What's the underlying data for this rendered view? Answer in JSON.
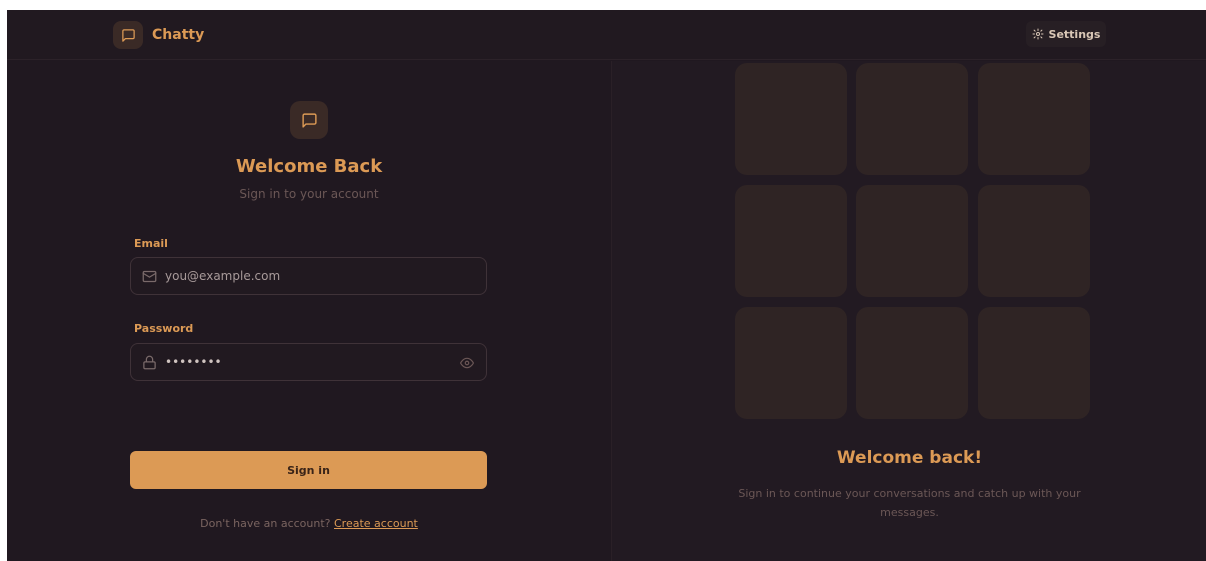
{
  "navbar": {
    "app_name": "Chatty",
    "settings_label": "Settings"
  },
  "login": {
    "title": "Welcome Back",
    "subtitle": "Sign in to your account",
    "email_label": "Email",
    "email_placeholder": "you@example.com",
    "password_label": "Password",
    "password_value": "••••••••",
    "submit_label": "Sign in",
    "signup_prompt": "Don't have an account?",
    "signup_link": "Create account"
  },
  "promo": {
    "title": "Welcome back!",
    "subtitle": "Sign in to continue your conversations and catch up with your messages."
  },
  "colors": {
    "accent": "#dc9a55",
    "background": "#201820",
    "tile": "#2f2424",
    "muted_text": "#6b5756"
  },
  "icons": [
    "message-square-icon",
    "settings-gear-icon",
    "mail-icon",
    "lock-icon",
    "eye-icon"
  ]
}
